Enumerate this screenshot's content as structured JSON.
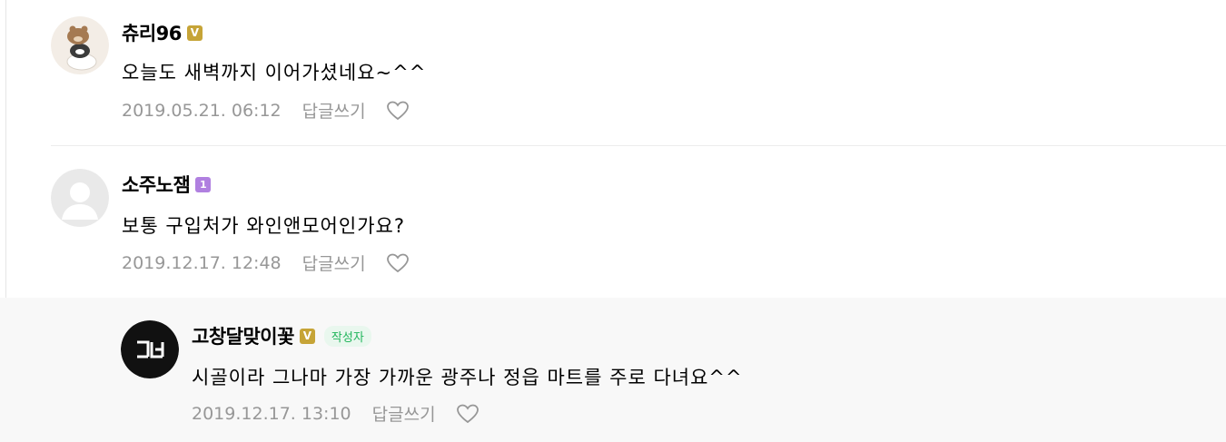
{
  "comments": [
    {
      "nickname": "츄리96",
      "badge": "V",
      "text": "오늘도 새벽까지 이어가셨네요~^^",
      "date": "2019.05.21. 06:12",
      "reply_label": "답글쓰기",
      "avatar_icon": "bear-stack-avatar-icon"
    },
    {
      "nickname": "소주노잼",
      "badge": "1",
      "text": "보통 구입처가 와인앤모어인가요?",
      "date": "2019.12.17. 12:48",
      "reply_label": "답글쓰기",
      "avatar_icon": "default-user-avatar-icon"
    }
  ],
  "reply": {
    "nickname": "고창달맞이꽃",
    "badge": "V",
    "author_tag": "작성자",
    "text": "시골이라 그나마 가장 가까운 광주나 정읍 마트를 주로 다녀요^^",
    "date": "2019.12.17. 13:10",
    "reply_label": "답글쓰기",
    "avatar_icon": "logo-avatar-icon"
  },
  "colors": {
    "meta_gray": "#979797",
    "badge_gold": "#c6a437",
    "badge_purple": "#b080e0",
    "author_green": "#1fb45a",
    "reply_bg": "#f8f8f8"
  }
}
